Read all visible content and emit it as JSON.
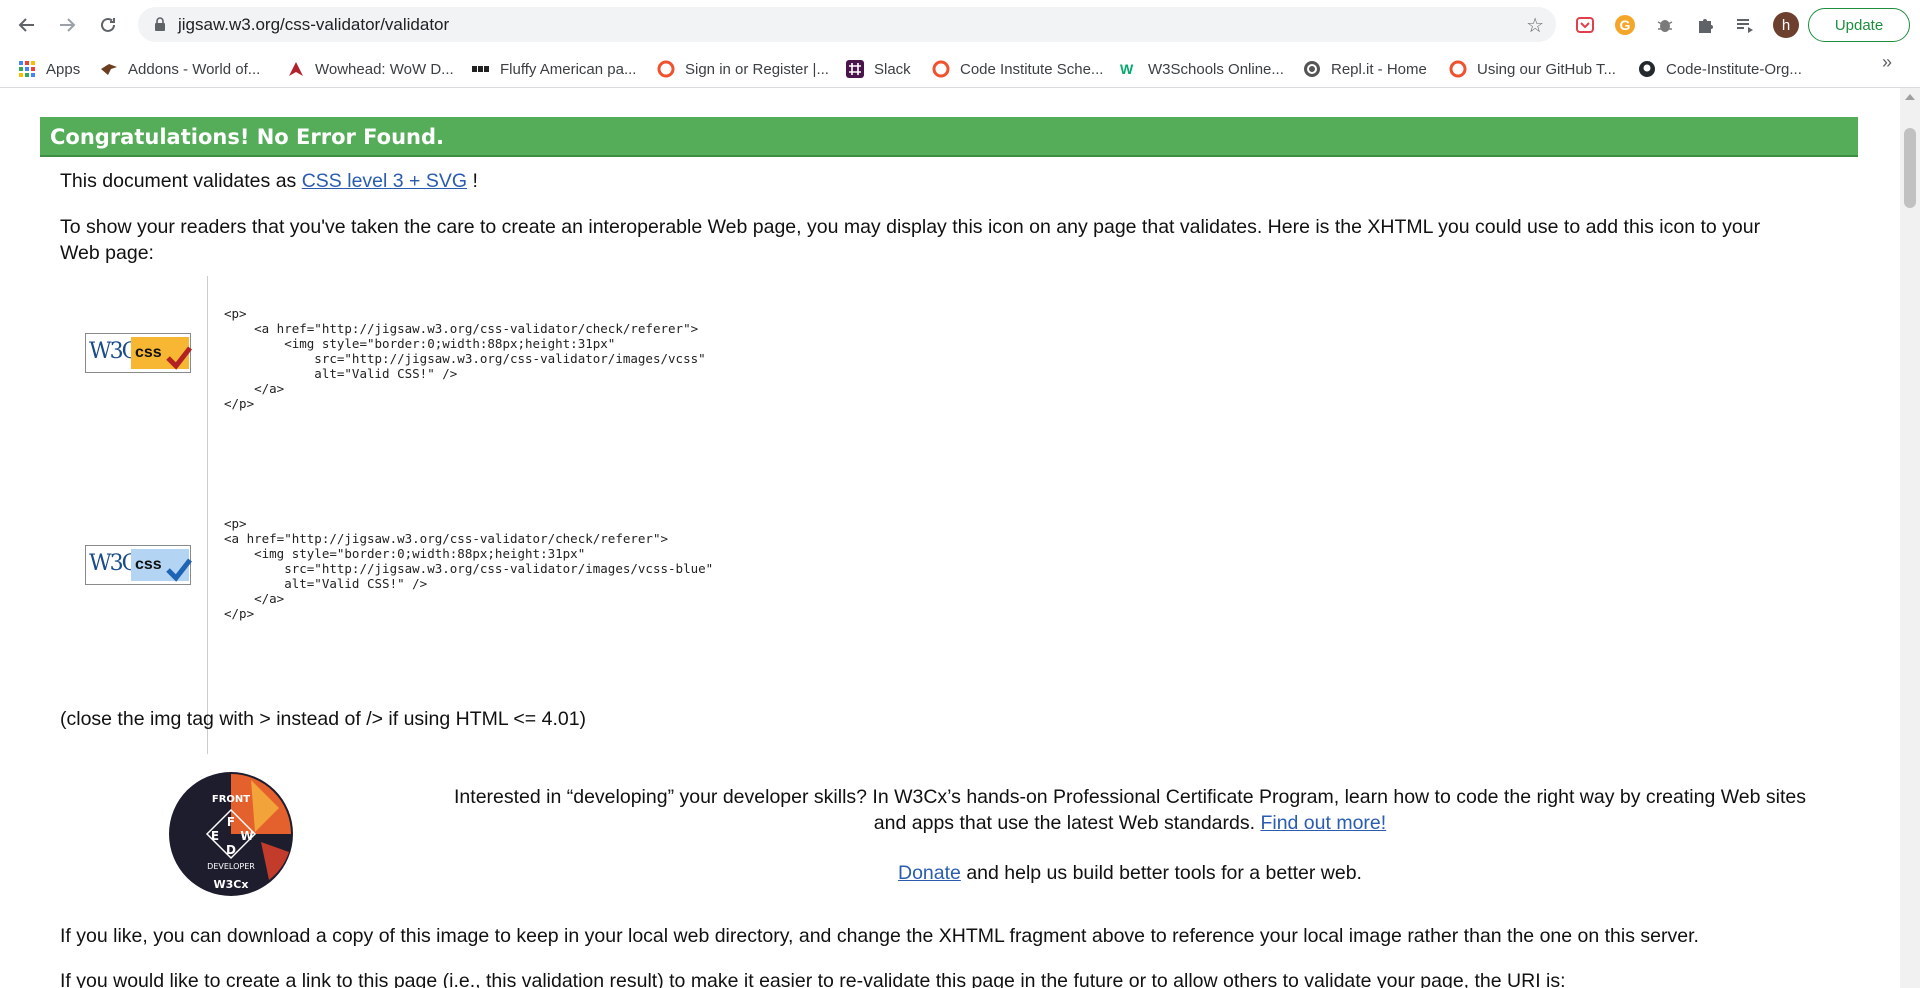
{
  "browser": {
    "url": "jigsaw.w3.org/css-validator/validator",
    "update_label": "Update",
    "avatar_initial": "h",
    "bookmarks": [
      {
        "label": "Apps",
        "icon": "apps-grid-icon"
      },
      {
        "label": "Addons - World of...",
        "icon": "addons-icon"
      },
      {
        "label": "Wowhead: WoW D...",
        "icon": "wowhead-icon"
      },
      {
        "label": "Fluffy American pa...",
        "icon": "bbc-icon"
      },
      {
        "label": "Sign in or Register |...",
        "icon": "code-institute-icon"
      },
      {
        "label": "Slack",
        "icon": "slack-icon"
      },
      {
        "label": "Code Institute Sche...",
        "icon": "code-institute-icon"
      },
      {
        "label": "W3Schools Online...",
        "icon": "w3schools-icon"
      },
      {
        "label": "Repl.it - Home",
        "icon": "replit-icon"
      },
      {
        "label": "Using our GitHub T...",
        "icon": "code-institute-icon"
      },
      {
        "label": "Code-Institute-Org...",
        "icon": "github-icon"
      }
    ],
    "more_label": "»"
  },
  "content": {
    "success_title": "Congratulations! No Error Found.",
    "validates_prefix": "This document validates as",
    "validates_link": "CSS level 3 + SVG",
    "validates_suffix": "!",
    "intro_line1": "To show your readers that you've taken the care to create an interoperable Web page, you may display this icon on any page that validates. Here is the XHTML you could use to add this icon to your",
    "intro_line2": "Web page:",
    "badge_w3c": "W3C",
    "badge_css": "css",
    "snippet1": "<p>\n    <a href=\"http://jigsaw.w3.org/css-validator/check/referer\">\n        <img style=\"border:0;width:88px;height:31px\"\n            src=\"http://jigsaw.w3.org/css-validator/images/vcss\"\n            alt=\"Valid CSS!\" />\n    </a>\n</p>",
    "snippet2": "<p>\n<a href=\"http://jigsaw.w3.org/css-validator/check/referer\">\n    <img style=\"border:0;width:88px;height:31px\"\n        src=\"http://jigsaw.w3.org/css-validator/images/vcss-blue\"\n        alt=\"Valid CSS!\" />\n    </a>\n</p>",
    "close_note": "(close the img tag with > instead of /> if using HTML <= 4.01)",
    "promo_line1": "Interested in “developing” your developer skills? In W3Cx’s hands-on Professional Certificate Program, learn how to code the right way by creating Web sites",
    "promo_line2": "and apps that use the latest Web standards.",
    "promo_link": "Find out more!",
    "donate_link": "Donate",
    "donate_text": "and help us build better tools for a better web.",
    "download_note": "If you like, you can download a copy of this image to keep in your local web directory, and change the XHTML fragment above to reference your local image rather than the one on this server.",
    "link_note": "If you would like to create a link to this page (i.e., this validation result) to make it easier to re-validate this page in the future or to allow others to validate your page, the URI is:",
    "logo_letters": [
      "F",
      "E",
      "W",
      "D"
    ],
    "logo_ring": "FRONT END WEB DEVELOPER",
    "logo_brand": "W3Cx"
  },
  "colors": {
    "success_green": "#55ad59",
    "link_blue": "#2a5db0",
    "badge_orange": "#f7b733",
    "badge_blue": "#b3d4f2",
    "check_red": "#b22222",
    "check_blue": "#1f64b4"
  }
}
